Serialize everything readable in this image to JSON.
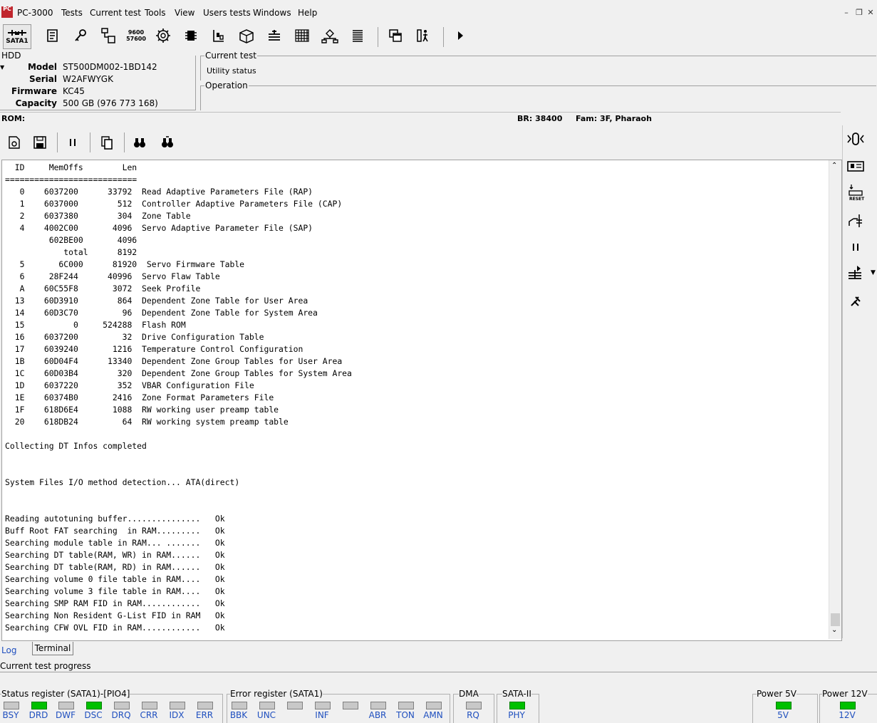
{
  "app": {
    "title": "PC-3000",
    "logo_text": "PC",
    "menu": [
      "Tests",
      "Current test",
      "Tools",
      "View",
      "Users tests",
      "Windows",
      "Help"
    ]
  },
  "toolbar": {
    "port_label": "SATA1",
    "baud_top": "9600",
    "baud_bottom": "57600"
  },
  "hdd": {
    "group_title": "HDD",
    "fields": [
      {
        "label": "Model",
        "value": "ST500DM002-1BD142"
      },
      {
        "label": "Serial",
        "value": "W2AFWYGK"
      },
      {
        "label": "Firmware",
        "value": "KC45"
      },
      {
        "label": "Capacity",
        "value": "500 GB (976 773 168)"
      }
    ]
  },
  "current_test": {
    "title": "Current test",
    "value": "Utility status"
  },
  "operation": {
    "title": "Operation"
  },
  "rom_bar": {
    "rom": "ROM:",
    "br": "BR: 38400",
    "fam": "Fam: 3F, Pharaoh"
  },
  "log": {
    "lines": [
      "  ID     MemOffs        Len",
      "===========================",
      "   0    6037200      33792  Read Adaptive Parameters File (RAP)",
      "   1    6037000        512  Controller Adaptive Parameters File (CAP)",
      "   2    6037380        304  Zone Table",
      "   4    4002C00       4096  Servo Adaptive Parameter File (SAP)",
      "         602BE00       4096",
      "            total      8192",
      "   5       6C000      81920  Servo Firmware Table",
      "   6     28F244      40996  Servo Flaw Table",
      "   A    60C55F8       3072  Seek Profile",
      "  13    60D3910        864  Dependent Zone Table for User Area",
      "  14    60D3C70         96  Dependent Zone Table for System Area",
      "  15          0     524288  Flash ROM",
      "  16    6037200         32  Drive Configuration Table",
      "  17    6039240       1216  Temperature Control Configuration",
      "  1B    60D04F4      13340  Dependent Zone Group Tables for User Area",
      "  1C    60D03B4        320  Dependent Zone Group Tables for System Area",
      "  1D    6037220        352  VBAR Configuration File",
      "  1E    60374B0       2416  Zone Format Parameters File",
      "  1F    618D6E4       1088  RW working user preamp table",
      "  20    618DB24         64  RW working system preamp table",
      "",
      "Collecting DT Infos completed",
      "",
      "",
      "System Files I/O method detection... ATA(direct)",
      "",
      "",
      "Reading autotuning buffer...............   Ok",
      "Buff Root FAT searching  in RAM.........   Ok",
      "Searching module table in RAM... .......   Ok",
      "Searching DT table(RAM, WR) in RAM......   Ok",
      "Searching DT table(RAM, RD) in RAM......   Ok",
      "Searching volume 0 file table in RAM....   Ok",
      "Searching volume 3 file table in RAM....   Ok",
      "Searching SMP RAM FID in RAM............   Ok",
      "Searching Non Resident G-List FID in RAM   Ok",
      "Searching CFW OVL FID in RAM............   Ok"
    ]
  },
  "tabs": [
    {
      "label": "Log",
      "active": false
    },
    {
      "label": "Terminal",
      "active": true
    }
  ],
  "progress": {
    "label": "Current test progress"
  },
  "status_register": {
    "title": "Status register (SATA1)-[PIO4]",
    "leds": [
      {
        "label": "BSY",
        "on": false
      },
      {
        "label": "DRD",
        "on": true
      },
      {
        "label": "DWF",
        "on": false
      },
      {
        "label": "DSC",
        "on": true
      },
      {
        "label": "DRQ",
        "on": false
      },
      {
        "label": "CRR",
        "on": false
      },
      {
        "label": "IDX",
        "on": false
      },
      {
        "label": "ERR",
        "on": false
      }
    ]
  },
  "error_register": {
    "title": "Error register (SATA1)",
    "leds": [
      {
        "label": "BBK",
        "on": false
      },
      {
        "label": "UNC",
        "on": false
      },
      {
        "label": "",
        "on": false
      },
      {
        "label": "INF",
        "on": false
      },
      {
        "label": "",
        "on": false
      },
      {
        "label": "ABR",
        "on": false
      },
      {
        "label": "TON",
        "on": false
      },
      {
        "label": "AMN",
        "on": false
      }
    ]
  },
  "dma": {
    "title": "DMA",
    "led": {
      "label": "RQ",
      "on": false
    }
  },
  "sata": {
    "title": "SATA-II",
    "led": {
      "label": "PHY",
      "on": true
    }
  },
  "power5": {
    "title": "Power 5V",
    "led": {
      "label": "5V",
      "on": true
    }
  },
  "power12": {
    "title": "Power 12V",
    "led": {
      "label": "12V",
      "on": true
    }
  },
  "colors": {
    "led_on": "#00c000",
    "led_off": "#c8c8c8",
    "led_label": "#1f4fbf",
    "accent": "#c0262d"
  }
}
